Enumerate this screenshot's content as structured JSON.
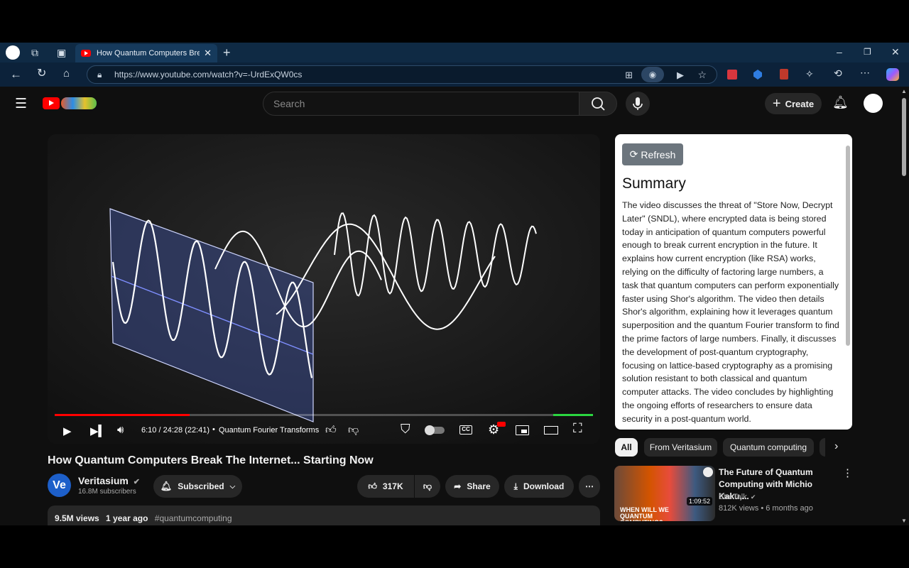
{
  "browser": {
    "tab_title": "How Quantum Computers Break",
    "url": "https://www.youtube.com/watch?v=-UrdExQW0cs"
  },
  "youtube": {
    "search_placeholder": "Search",
    "create_label": "Create"
  },
  "player": {
    "time": "6:10 / 24:28 (22:41)",
    "chapter": "Quantum Fourier Transforms",
    "progress": 0.25
  },
  "video": {
    "title": "How Quantum Computers Break The Internet... Starting Now",
    "channel": "Veritasium",
    "channel_avatar_text": "Ve",
    "subscribers": "16.8M subscribers",
    "subscribed_label": "Subscribed",
    "likes": "317K",
    "share_label": "Share",
    "download_label": "Download",
    "views": "9.5M views",
    "age": "1 year ago",
    "hashtag": "#quantumcomputing"
  },
  "summary": {
    "refresh_label": "Refresh",
    "heading": "Summary",
    "text": "The video discusses the threat of \"Store Now, Decrypt Later\" (SNDL), where encrypted data is being stored today in anticipation of quantum computers powerful enough to break current encryption in the future. It explains how current encryption (like RSA) works, relying on the difficulty of factoring large numbers, a task that quantum computers can perform exponentially faster using Shor's algorithm. The video then details Shor's algorithm, explaining how it leverages quantum superposition and the quantum Fourier transform to find the prime factors of large numbers. Finally, it discusses the development of post-quantum cryptography, focusing on lattice-based cryptography as a promising solution resistant to both classical and quantum computer attacks. The video concludes by highlighting the ongoing efforts of researchers to ensure data security in a post-quantum world."
  },
  "chips": [
    "All",
    "From Veritasium",
    "Quantum computing"
  ],
  "recommendation": {
    "title": "The Future of Quantum Computing with Michio Kaku,...",
    "channel": "StarTalk",
    "views": "812K views",
    "age": "6 months ago",
    "duration": "1:09:52",
    "thumb_text": "WHEN WILL WE QUANTUM COMPUTING?"
  },
  "colors": {
    "youtube_red": "#ff0000",
    "browser_frame": "#0f2a44",
    "page_bg": "#0f0f0f"
  }
}
